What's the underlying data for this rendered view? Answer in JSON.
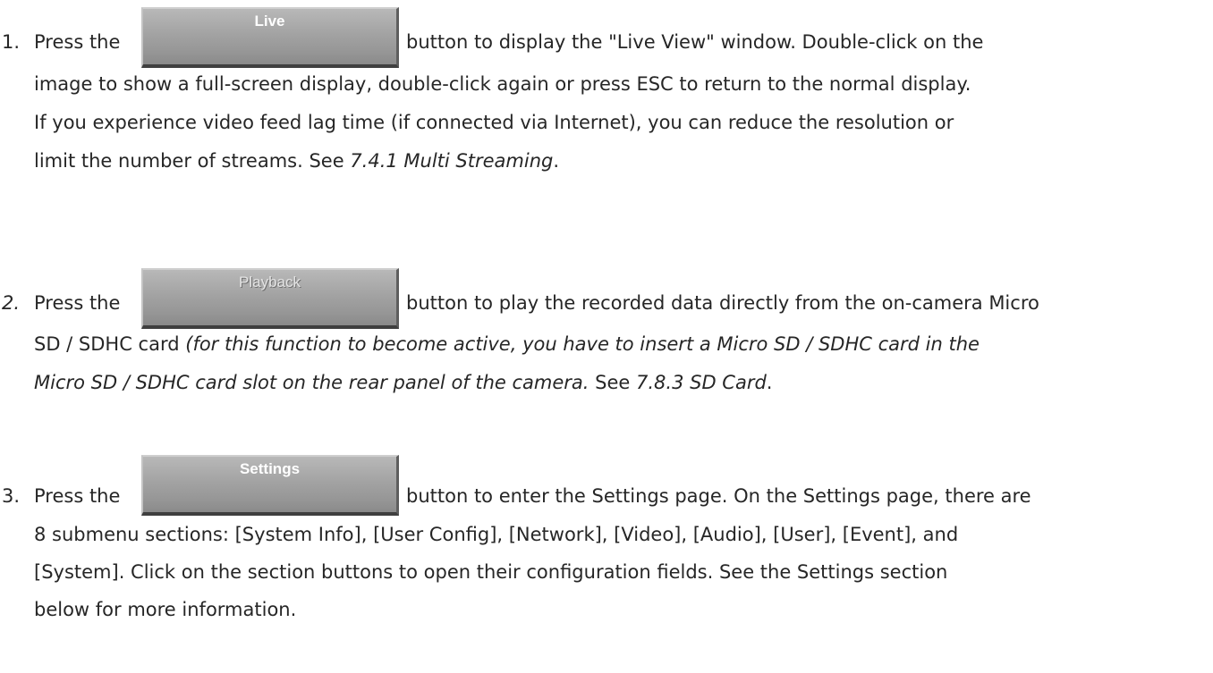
{
  "items": [
    {
      "number": "1.",
      "lead": "Press the",
      "button_label": "Live",
      "lines": [
        "button to display the \"Live View\" window. Double-click on the",
        "image to show a full-screen display, double-click again or press ESC to return to the normal display.",
        "If you experience video feed lag time (if connected via Internet), you can reduce the resolution or"
      ],
      "last_line_prefix": "limit the number of streams. See ",
      "last_line_ref": "7.4.1 Multi Streaming",
      "last_line_suffix": "."
    },
    {
      "number": "2.",
      "lead": "Press the",
      "button_label": "Playback",
      "line1": "button to play the recorded data directly from the on-camera Micro",
      "line2_prefix": "SD / SDHC card ",
      "line2_italic": "(for this function to become active, you have to insert a Micro SD / SDHC card in the",
      "line3_italic": "Micro SD / SDHC card slot on the rear panel of the camera.",
      "line3_mid": " See ",
      "line3_ref": "7.8.3 SD Card",
      "line3_suffix": "."
    },
    {
      "number": "3.",
      "lead": "Press the",
      "button_label": "Settings",
      "lines": [
        "button to enter the Settings page. On the Settings page, there are",
        "8 submenu sections: [System Info], [User Config], [Network], [Video], [Audio], [User], [Event], and",
        "[System]. Click on the section buttons to open their configuration fields. See the Settings section",
        "below for more information."
      ]
    }
  ]
}
